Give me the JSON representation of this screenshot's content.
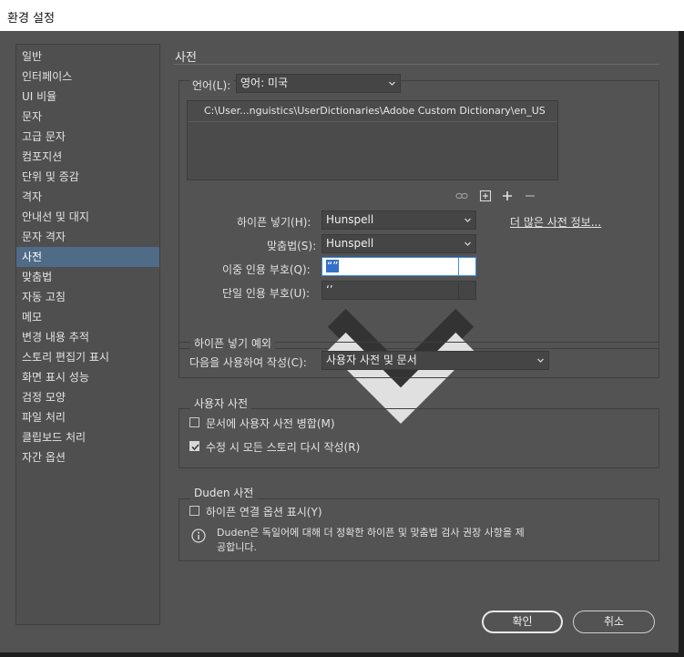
{
  "window": {
    "title": "환경 설정"
  },
  "sidebar": {
    "items": [
      {
        "label": "일반"
      },
      {
        "label": "인터페이스"
      },
      {
        "label": "UI 비율"
      },
      {
        "label": "문자"
      },
      {
        "label": "고급 문자"
      },
      {
        "label": "컴포지션"
      },
      {
        "label": "단위 및 증감"
      },
      {
        "label": "격자"
      },
      {
        "label": "안내선 및 대지"
      },
      {
        "label": "문자 격자"
      },
      {
        "label": "사전"
      },
      {
        "label": "맞춤법"
      },
      {
        "label": "자동 고침"
      },
      {
        "label": "메모"
      },
      {
        "label": "변경 내용 추적"
      },
      {
        "label": "스토리 편집기 표시"
      },
      {
        "label": "화면 표시 성능"
      },
      {
        "label": "검정 모양"
      },
      {
        "label": "파일 처리"
      },
      {
        "label": "클립보드 처리"
      },
      {
        "label": "자간 옵션"
      }
    ],
    "selected": "사전"
  },
  "main": {
    "title": "사전",
    "language": {
      "label": "언어(L):",
      "value": "영어: 미국"
    },
    "dictionary_list": [
      "C:\\User...nguistics\\UserDictionaries\\Adobe Custom Dictionary\\en_US"
    ],
    "list_tools": {
      "link": "link-icon",
      "add_file": "add-file-icon",
      "add": "plus-icon",
      "remove": "minus-icon"
    },
    "hyphenation": {
      "label": "하이픈 넣기(H):",
      "value": "Hunspell"
    },
    "more_info_link": "더 많은 사전 정보...",
    "spelling": {
      "label": "맞춤법(S):",
      "value": "Hunspell"
    },
    "double_quotes": {
      "label": "이중 인용 부호(Q):",
      "value": "“”"
    },
    "single_quotes": {
      "label": "단일 인용 부호(U):",
      "value": "‘’"
    }
  },
  "hyphenation_exceptions": {
    "legend": "하이픈 넣기 예외",
    "compose_label": "다음을 사용하여 작성(C):",
    "compose_value": "사용자 사전 및 문서"
  },
  "user_dictionary": {
    "legend": "사용자 사전",
    "merge": {
      "label": "문서에 사용자 사전 병합(M)",
      "checked": false
    },
    "recompose": {
      "label": "수정 시 모든 스토리 다시 작성(R)",
      "checked": true
    }
  },
  "duden": {
    "legend": "Duden 사전",
    "show_options": {
      "label": "하이픈 연결 옵션 표시(Y)",
      "checked": false
    },
    "info_line1": "Duden은 독일어에 대해 더 정확한 하이픈 및 맞춤법 검사 권장 사항을 제",
    "info_line2": "공합니다."
  },
  "footer": {
    "ok": "확인",
    "cancel": "취소"
  },
  "colors": {
    "dialog_bg": "#535353",
    "selected": "#4f6b87",
    "focus": "#3b8de0"
  }
}
